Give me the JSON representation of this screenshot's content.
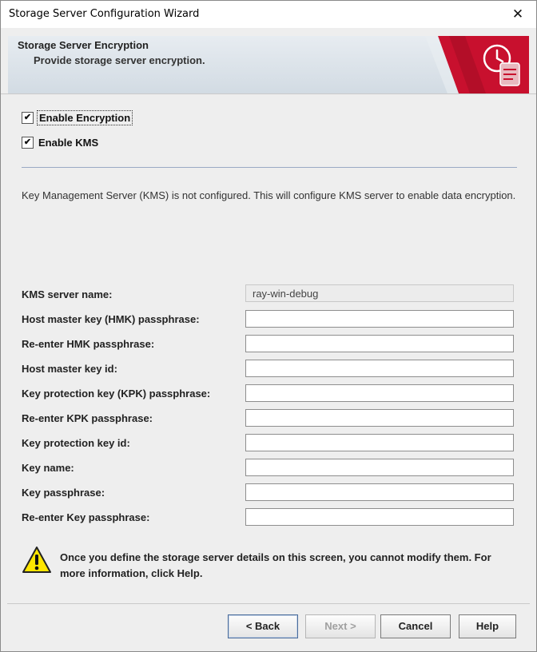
{
  "window": {
    "title": "Storage Server Configuration Wizard",
    "close_glyph": "✕"
  },
  "banner": {
    "title": "Storage Server Encryption",
    "subtitle": "Provide storage server encryption."
  },
  "checkboxes": [
    {
      "label": "Enable Encryption",
      "checked": true
    },
    {
      "label": "Enable KMS",
      "checked": true
    }
  ],
  "info_text": "Key Management Server (KMS) is not configured. This will configure KMS server to enable data encryption.",
  "fields": [
    {
      "label": "KMS server name:",
      "value": "ray-win-debug",
      "readonly": true
    },
    {
      "label": "Host master key (HMK) passphrase:",
      "value": ""
    },
    {
      "label": "Re-enter HMK passphrase:",
      "value": ""
    },
    {
      "label": "Host master key id:",
      "value": ""
    },
    {
      "label": "Key protection key (KPK) passphrase:",
      "value": ""
    },
    {
      "label": "Re-enter KPK passphrase:",
      "value": ""
    },
    {
      "label": "Key protection key id:",
      "value": ""
    },
    {
      "label": "Key name:",
      "value": ""
    },
    {
      "label": "Key passphrase:",
      "value": ""
    },
    {
      "label": "Re-enter Key passphrase:",
      "value": ""
    }
  ],
  "warning_text": "Once you define the storage server details on this screen, you cannot modify them. For more information, click Help.",
  "buttons": {
    "back": "< Back",
    "next": "Next >",
    "cancel": "Cancel",
    "help": "Help"
  },
  "icons": {
    "banner_icon": "wizard-clock-scroll-icon",
    "warning_icon": "warning-triangle-icon"
  },
  "colors": {
    "accent_red": "#c8102e",
    "banner_bg": "#d9e1e8"
  }
}
